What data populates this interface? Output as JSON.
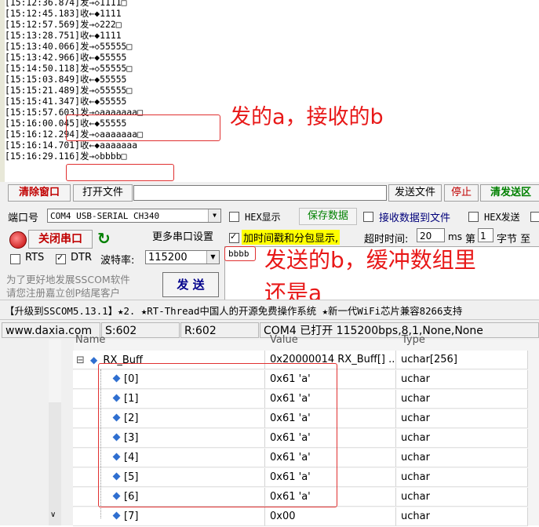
{
  "log": {
    "lines": [
      "[15:12:36.874]发→◇1111□",
      "[15:12:45.183]收←◆1111",
      "[15:12:57.569]发→◇222□",
      "[15:13:28.751]收←◆1111",
      "[15:13:40.066]发→◇55555□",
      "[15:13:42.966]收←◆55555",
      "[15:14:50.118]发→◇55555□",
      "[15:15:03.849]收←◆55555",
      "[15:15:21.489]发→◇55555□",
      "[15:15:41.347]收←◆55555",
      "[15:15:57.603]发→◇aaaaaaa□",
      "[15:16:00.045]收←◆55555",
      "[15:16:12.294]发→◇aaaaaaa□",
      "[15:16:14.701]收←◆aaaaaaa",
      "[15:16:29.116]发→◇bbbb□"
    ]
  },
  "annotations": {
    "note1": "发的a，接收的b",
    "note2_line1": "发送的b，缓冲数组里",
    "note2_line2": "还是a"
  },
  "toolbar": {
    "clear_window": "清除窗口",
    "open_file": "打开文件",
    "send_file": "发送文件",
    "stop": "停止",
    "clear_send_area": "清发送区"
  },
  "port": {
    "port_label": "端口号",
    "port_value": "COM4 USB-SERIAL CH340",
    "close_port": "关闭串口",
    "more_settings": "更多串口设置",
    "rts_label": "RTS",
    "dtr_label": "DTR",
    "baud_label": "波特率:",
    "baud_value": "115200",
    "promo_line1": "为了更好地发展SSCOM软件",
    "promo_line2": "请您注册嘉立创P结尾客户",
    "send_button": "发 送"
  },
  "options": {
    "hex_display": "HEX显示",
    "save_data": "保存数据",
    "recv_to_file": "接收数据到文件",
    "hex_send": "HEX发送",
    "timestamp_label": "加时间戳和分包显示,",
    "timeout_label": "超时时间:",
    "timeout_value": "20",
    "timeout_unit": "ms",
    "nth_label": "第",
    "nth_value": "1",
    "byte_label": "字节 至"
  },
  "send_text": "bbbb",
  "ticker": "【升级到SSCOM5.13.1】★2. ★RT-Thread中国人的开源免费操作系统 ★新一代WiFi芯片兼容8266支持",
  "statusbar": {
    "website": "www.daxia.com",
    "sent": "S:602",
    "received": "R:602",
    "port_status": "COM4 已打开  115200bps,8,1,None,None"
  },
  "watch": {
    "headers": {
      "name": "Name",
      "value": "Value",
      "type": "Type"
    },
    "parent": {
      "name": "RX_Buff",
      "value": "0x20000014 RX_Buff[] ...",
      "type": "uchar[256]",
      "expand": "⊟"
    },
    "rows": [
      {
        "name": "[0]",
        "value": "0x61 'a'",
        "type": "uchar"
      },
      {
        "name": "[1]",
        "value": "0x61 'a'",
        "type": "uchar"
      },
      {
        "name": "[2]",
        "value": "0x61 'a'",
        "type": "uchar"
      },
      {
        "name": "[3]",
        "value": "0x61 'a'",
        "type": "uchar"
      },
      {
        "name": "[4]",
        "value": "0x61 'a'",
        "type": "uchar"
      },
      {
        "name": "[5]",
        "value": "0x61 'a'",
        "type": "uchar"
      },
      {
        "name": "[6]",
        "value": "0x61 'a'",
        "type": "uchar"
      },
      {
        "name": "[7]",
        "value": "0x00",
        "type": "uchar"
      }
    ]
  },
  "colors": {
    "annotation_red": "#e81818",
    "stop_red": "#c00000",
    "save_green": "#008000"
  }
}
